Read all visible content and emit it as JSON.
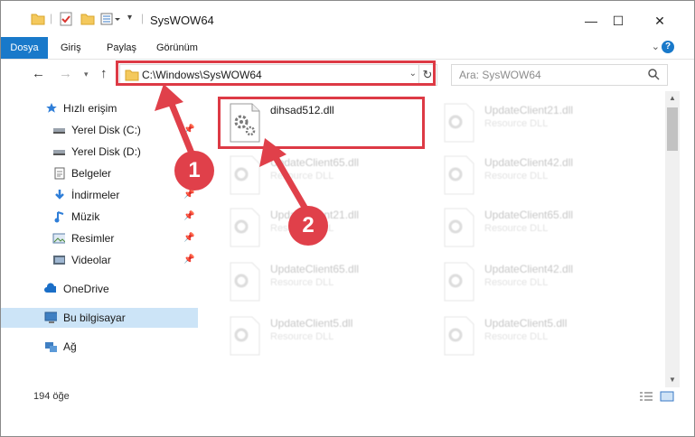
{
  "window": {
    "title": "SysWOW64",
    "minimize": "—",
    "maximize": "☐",
    "close": "✕"
  },
  "ribbon": {
    "tabs": [
      "Dosya",
      "Giriş",
      "Paylaş",
      "Görünüm"
    ]
  },
  "address": {
    "path": "C:\\Windows\\SysWOW64",
    "search_placeholder": "Ara: SysWOW64"
  },
  "nav": {
    "items": [
      {
        "label": "Hızlı erişim",
        "icon": "star-icon"
      },
      {
        "label": "Yerel Disk (C:)",
        "icon": "drive-icon"
      },
      {
        "label": "Yerel Disk (D:)",
        "icon": "drive-icon"
      },
      {
        "label": "Belgeler",
        "icon": "documents-icon"
      },
      {
        "label": "İndirmeler",
        "icon": "download-icon"
      },
      {
        "label": "Müzik",
        "icon": "music-icon"
      },
      {
        "label": "Resimler",
        "icon": "pictures-icon"
      },
      {
        "label": "Videolar",
        "icon": "videos-icon"
      },
      {
        "label": "OneDrive",
        "icon": "cloud-icon"
      },
      {
        "label": "Bu bilgisayar",
        "icon": "computer-icon"
      },
      {
        "label": "Ağ",
        "icon": "network-icon"
      }
    ]
  },
  "files": [
    {
      "name": "dihsad512.dll",
      "desc": ""
    },
    {
      "name": "UpdateClient21.dll",
      "desc": "Resource DLL"
    },
    {
      "name": "UpdateClient65.dll",
      "desc": "Resource DLL"
    },
    {
      "name": "UpdateClient42.dll",
      "desc": "Resource DLL"
    },
    {
      "name": "UpdateClient21.dll",
      "desc": "Resource DLL"
    },
    {
      "name": "UpdateClient65.dll",
      "desc": "Resource DLL"
    },
    {
      "name": "UpdateClient65.dll",
      "desc": "Resource DLL"
    },
    {
      "name": "UpdateClient42.dll",
      "desc": "Resource DLL"
    },
    {
      "name": "UpdateClient5.dll",
      "desc": "Resource DLL"
    },
    {
      "name": "UpdateClient5.dll",
      "desc": "Resource DLL"
    }
  ],
  "status": {
    "count": "194 öğe"
  },
  "annotations": {
    "step1": "1",
    "step2": "2",
    "color": "#e0404a"
  }
}
